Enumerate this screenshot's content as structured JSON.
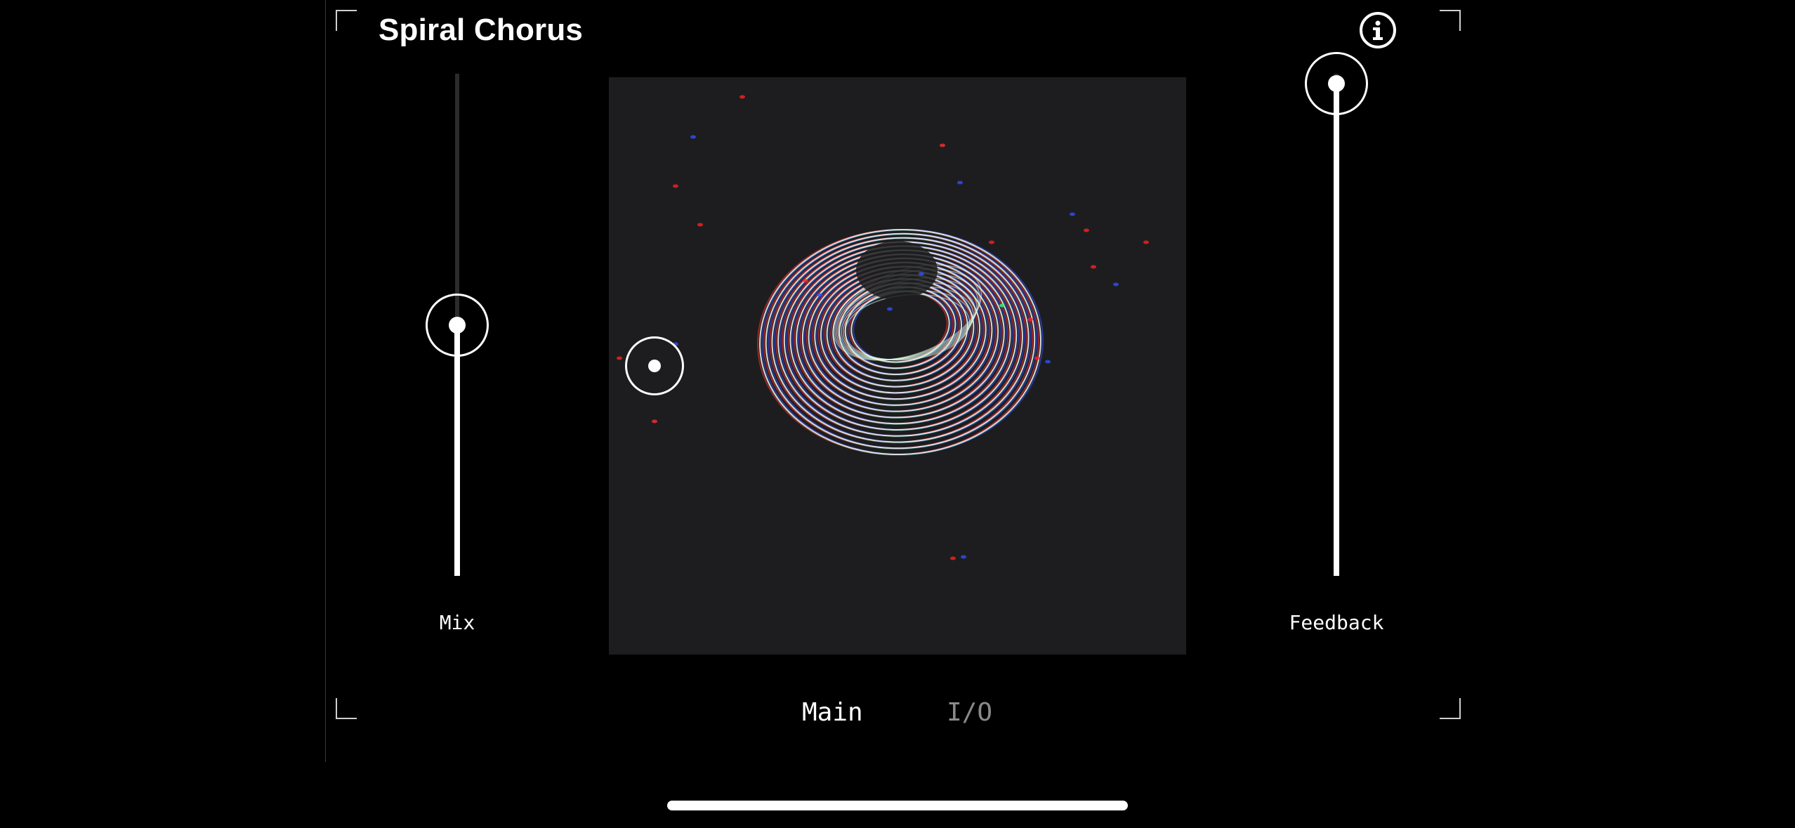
{
  "app": {
    "title": "Spiral Chorus"
  },
  "info_button": {
    "icon": "info-icon"
  },
  "sliders": {
    "mix": {
      "label": "Mix",
      "value": 0.5
    },
    "feedback": {
      "label": "Feedback",
      "value": 0.98
    }
  },
  "visualizer": {
    "handle_icon": "target-icon"
  },
  "tabs": [
    {
      "label": "Main",
      "active": true
    },
    {
      "label": "I/O",
      "active": false
    }
  ],
  "colors": {
    "background": "#000000",
    "panel": "#1d1d1f",
    "accent": "#ffffff",
    "inactive_tab": "#8a8a8a"
  }
}
